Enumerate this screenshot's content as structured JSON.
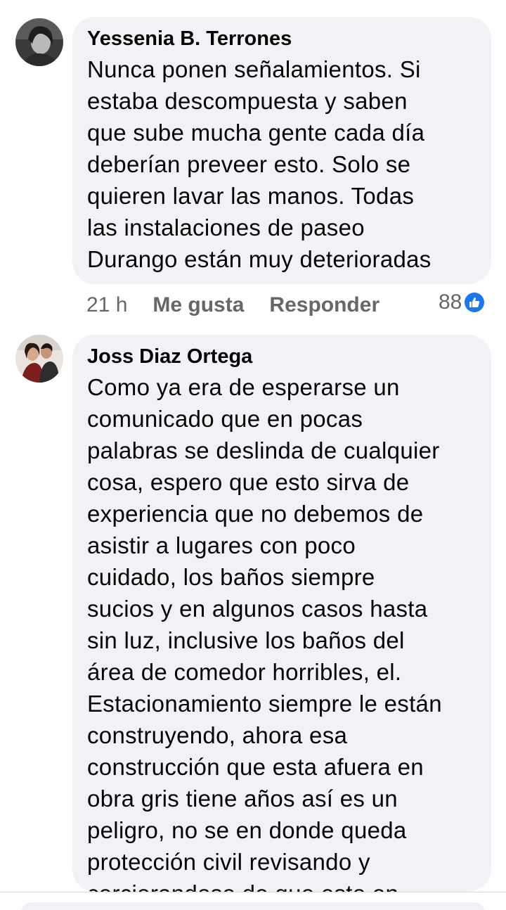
{
  "comments": [
    {
      "author": "Yessenia B. Terrones",
      "text": "Nunca ponen señalamientos. Si\nestaba descompuesta y saben\nque sube mucha gente cada día\ndeberían preveer esto. Solo se\nquieren lavar las manos. Todas\nlas instalaciones de paseo\nDurango están muy deterioradas",
      "time": "21 h",
      "like_label": "Me gusta",
      "reply_label": "Responder",
      "reaction_count": "88",
      "reaction_icon": "like-icon"
    },
    {
      "author": "Joss Diaz Ortega",
      "text": "Como ya era de esperarse un\ncomunicado que en pocas\npalabras se deslinda de cualquier\ncosa, espero que esto sirva de\nexperiencia que no debemos de\nasistir a lugares con poco\ncuidado, los baños siempre\nsucios y en algunos casos hasta\nsin luz, inclusive los baños del\nárea de comedor horribles, el.\nEstacionamiento siempre le están\nconstruyendo, ahora esa\nconstrucción que esta afuera en\nobra gris tiene años así es un\npeligro, no se en donde queda\nprotección civil revisando y\ncerciorandose de que esto en"
    }
  ],
  "colors": {
    "bubble": "#f0f2f5",
    "meta_text": "#65676b",
    "like_blue": "#1877f2"
  }
}
